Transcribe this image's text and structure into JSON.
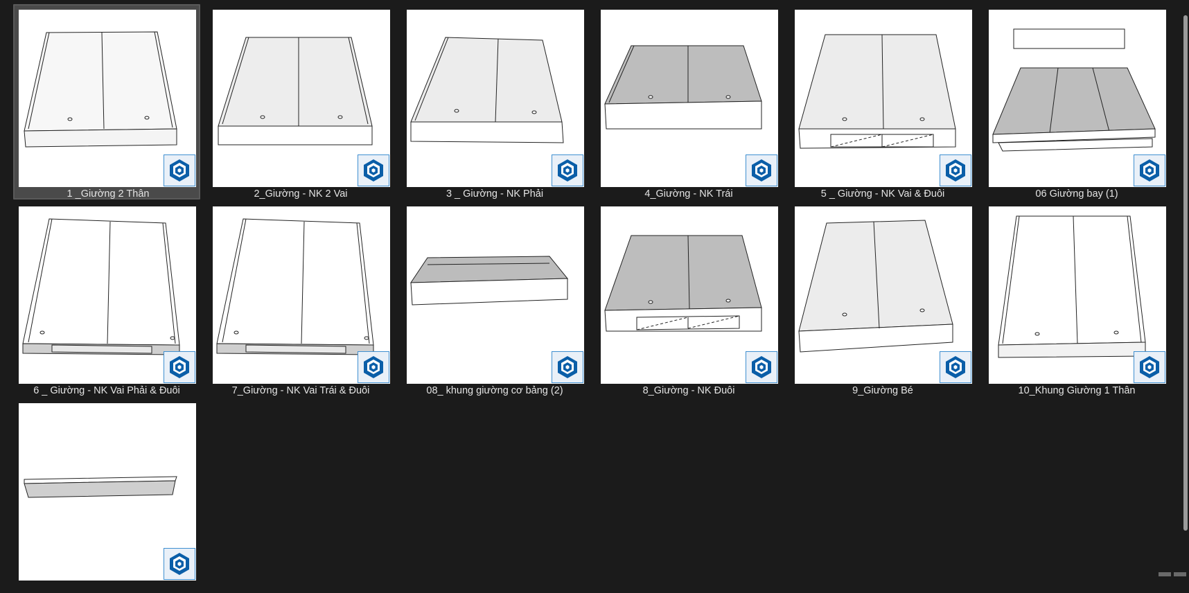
{
  "files": [
    {
      "name": "1 _Giường 2 Thân",
      "selected": true,
      "icon": "sketchup-icon",
      "variant": "A"
    },
    {
      "name": "2_Giường - NK 2 Vai",
      "selected": false,
      "icon": "sketchup-icon",
      "variant": "B"
    },
    {
      "name": "3 _ Giường - NK Phải",
      "selected": false,
      "icon": "sketchup-icon",
      "variant": "C"
    },
    {
      "name": "4_Giường - NK Trái",
      "selected": false,
      "icon": "sketchup-icon",
      "variant": "D"
    },
    {
      "name": "5 _ Giường - NK Vai & Đuôi",
      "selected": false,
      "icon": "sketchup-icon",
      "variant": "E"
    },
    {
      "name": "06 Giường bay (1)",
      "selected": false,
      "icon": "sketchup-icon",
      "variant": "F"
    },
    {
      "name": "6 _ Giường - NK Vai Phải & Đuôi",
      "selected": false,
      "icon": "sketchup-icon",
      "variant": "G"
    },
    {
      "name": "7_Giường - NK Vai Trái & Đuôi",
      "selected": false,
      "icon": "sketchup-icon",
      "variant": "G"
    },
    {
      "name": "08_ khung giường cơ bảng (2)",
      "selected": false,
      "icon": "sketchup-icon",
      "variant": "H"
    },
    {
      "name": "8_Giường - NK Đuôi",
      "selected": false,
      "icon": "sketchup-icon",
      "variant": "I"
    },
    {
      "name": "9_Giường Bé",
      "selected": false,
      "icon": "sketchup-icon",
      "variant": "J"
    },
    {
      "name": "10_Khung Giường 1 Thân",
      "selected": false,
      "icon": "sketchup-icon",
      "variant": "K"
    },
    {
      "name": "",
      "selected": false,
      "icon": "sketchup-icon",
      "variant": "L"
    }
  ],
  "colors": {
    "background": "#1b1b1b",
    "selection": "#4a4a4a",
    "label_text": "#e4e4e4",
    "sketchup_blue": "#0a5ea8"
  }
}
